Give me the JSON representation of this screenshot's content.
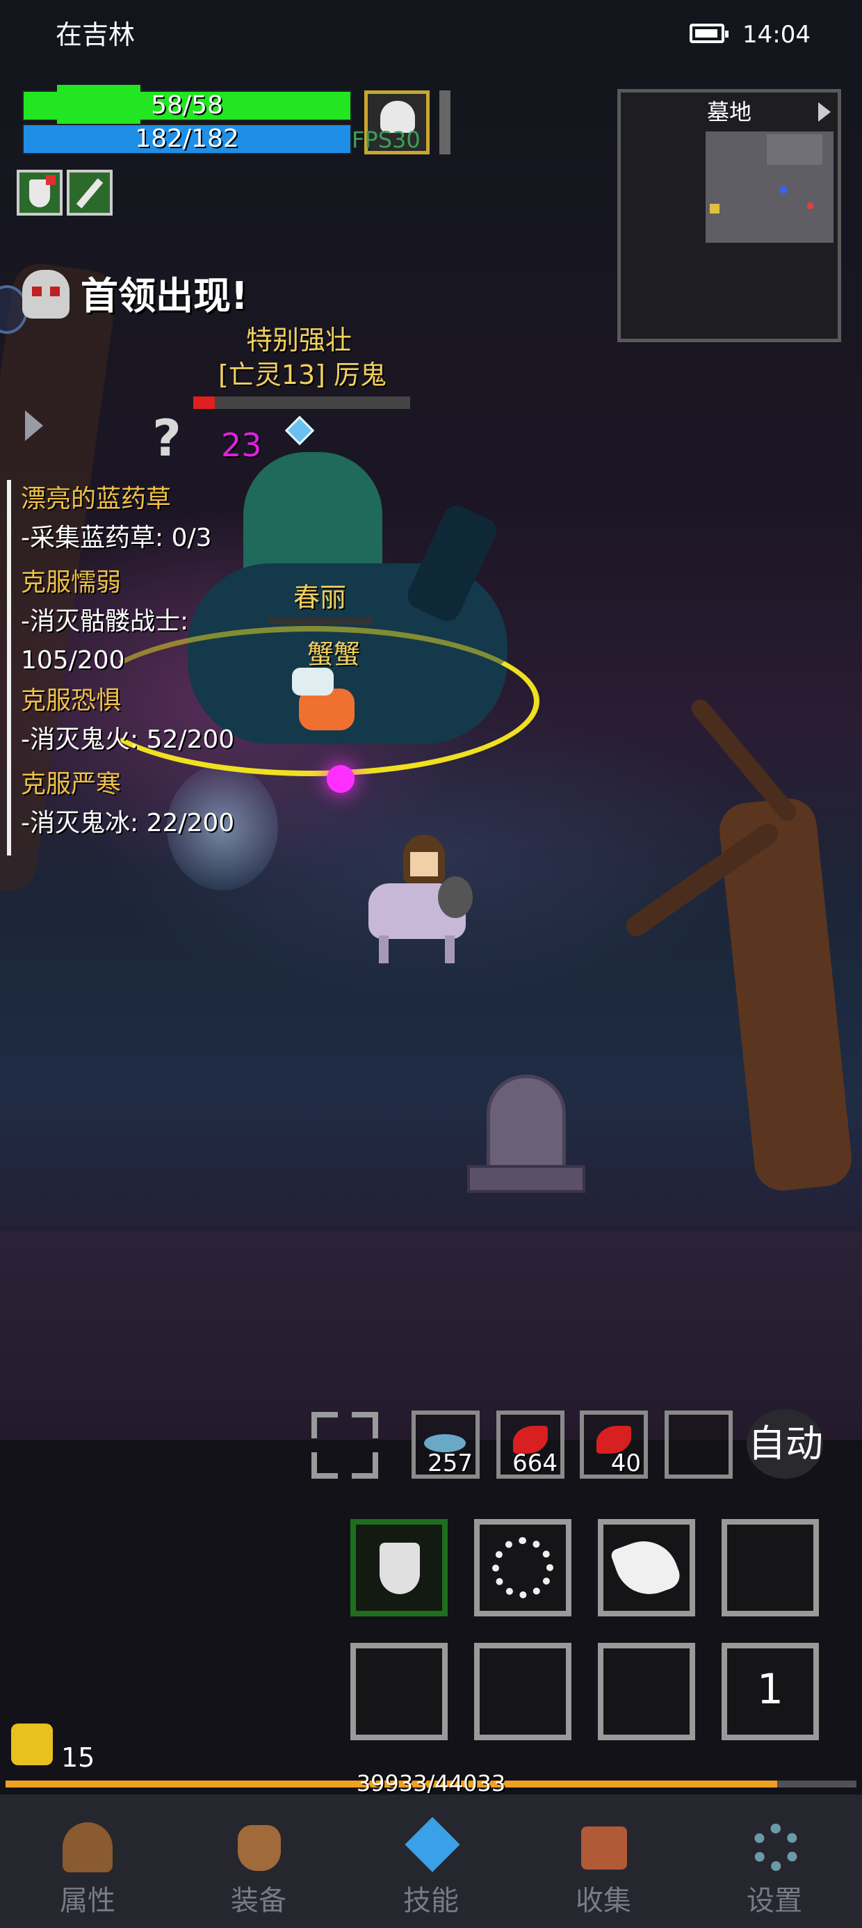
{
  "status_bar": {
    "location": "在吉林",
    "time": "14:04"
  },
  "player": {
    "hp": "58/58",
    "hp_fraction": 1.0,
    "mp": "182/182",
    "mp_fraction": 1.0,
    "fps": "FPS30"
  },
  "minimap": {
    "title": "墓地"
  },
  "boss": {
    "alert": "首领出现!",
    "trait": "特别强壮",
    "name": "[亡灵13] 厉鬼",
    "hp_fraction": 0.1,
    "damage": "23"
  },
  "npc": {
    "name": "春丽",
    "pet_name": "蟹蟹"
  },
  "quests": [
    {
      "title": "漂亮的蓝药草",
      "progress": "-采集蓝药草: 0/3"
    },
    {
      "title": "克服懦弱",
      "progress": "-消灭骷髅战士:",
      "progress2": "105/200"
    },
    {
      "title": "克服恐惧",
      "progress": "-消灭鬼火: 52/200"
    },
    {
      "title": "克服严寒",
      "progress": "-消灭鬼冰: 22/200"
    }
  ],
  "quickbar": {
    "items": [
      {
        "icon": "fish-icon",
        "count": "257"
      },
      {
        "icon": "red-leaf-icon",
        "count": "664"
      },
      {
        "icon": "red-leaf-icon",
        "count": "40"
      }
    ],
    "auto_label": "自动"
  },
  "skills": {
    "page": "1"
  },
  "level": {
    "value": "15",
    "xp": "39933/44033",
    "xp_fraction": 0.9069
  },
  "nav": [
    {
      "label": "属性",
      "icon": "helmet-icon"
    },
    {
      "label": "装备",
      "icon": "bag-icon"
    },
    {
      "label": "技能",
      "icon": "crystal-icon"
    },
    {
      "label": "收集",
      "icon": "book-icon"
    },
    {
      "label": "设置",
      "icon": "gear-icon"
    }
  ],
  "colors": {
    "hp": "#22e622",
    "mp": "#1e8ee6",
    "quest_title": "#f0c048",
    "xp": "#f0a020",
    "boss_text": "#f0d060",
    "damage": "#e020e0"
  }
}
